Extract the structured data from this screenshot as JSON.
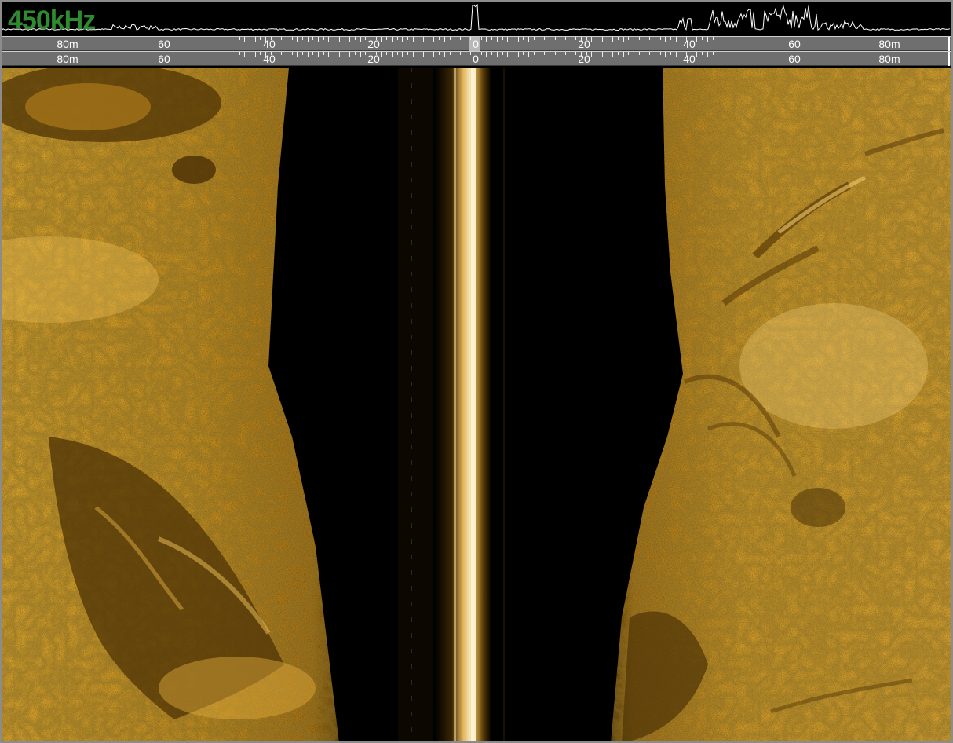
{
  "frequency_label": "450kHz",
  "ruler_top": {
    "left_labels": [
      "80m",
      "60",
      "40",
      "20"
    ],
    "center_label": "0",
    "right_labels": [
      "20",
      "40",
      "60",
      "80m"
    ]
  },
  "ruler_bottom": {
    "left_labels": [
      "80m",
      "60",
      "40",
      "20"
    ],
    "center_label": "0",
    "right_labels": [
      "20",
      "40",
      "60",
      "80m"
    ]
  },
  "colors": {
    "sand_light": "#f0bf4a",
    "sand_mid": "#c9911e",
    "sand_dark": "#6e4a0c",
    "water": "#000000",
    "frequency_text": "#2e8b2e",
    "ruler_bg": "#6f6f6f"
  }
}
